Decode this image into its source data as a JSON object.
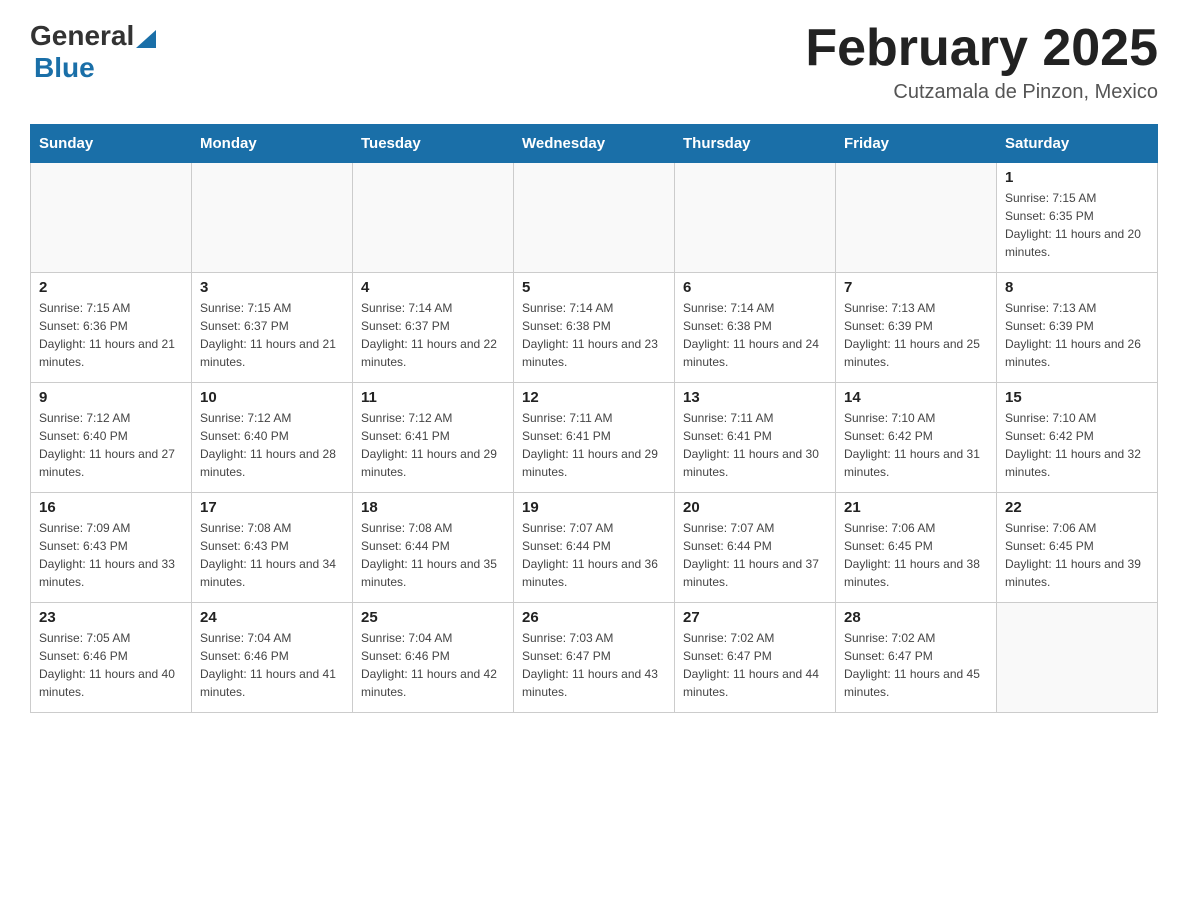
{
  "header": {
    "logo": {
      "general": "General",
      "blue": "Blue"
    },
    "title": "February 2025",
    "location": "Cutzamala de Pinzon, Mexico"
  },
  "days_of_week": [
    "Sunday",
    "Monday",
    "Tuesday",
    "Wednesday",
    "Thursday",
    "Friday",
    "Saturday"
  ],
  "weeks": [
    [
      {
        "day": "",
        "info": ""
      },
      {
        "day": "",
        "info": ""
      },
      {
        "day": "",
        "info": ""
      },
      {
        "day": "",
        "info": ""
      },
      {
        "day": "",
        "info": ""
      },
      {
        "day": "",
        "info": ""
      },
      {
        "day": "1",
        "info": "Sunrise: 7:15 AM\nSunset: 6:35 PM\nDaylight: 11 hours and 20 minutes."
      }
    ],
    [
      {
        "day": "2",
        "info": "Sunrise: 7:15 AM\nSunset: 6:36 PM\nDaylight: 11 hours and 21 minutes."
      },
      {
        "day": "3",
        "info": "Sunrise: 7:15 AM\nSunset: 6:37 PM\nDaylight: 11 hours and 21 minutes."
      },
      {
        "day": "4",
        "info": "Sunrise: 7:14 AM\nSunset: 6:37 PM\nDaylight: 11 hours and 22 minutes."
      },
      {
        "day": "5",
        "info": "Sunrise: 7:14 AM\nSunset: 6:38 PM\nDaylight: 11 hours and 23 minutes."
      },
      {
        "day": "6",
        "info": "Sunrise: 7:14 AM\nSunset: 6:38 PM\nDaylight: 11 hours and 24 minutes."
      },
      {
        "day": "7",
        "info": "Sunrise: 7:13 AM\nSunset: 6:39 PM\nDaylight: 11 hours and 25 minutes."
      },
      {
        "day": "8",
        "info": "Sunrise: 7:13 AM\nSunset: 6:39 PM\nDaylight: 11 hours and 26 minutes."
      }
    ],
    [
      {
        "day": "9",
        "info": "Sunrise: 7:12 AM\nSunset: 6:40 PM\nDaylight: 11 hours and 27 minutes."
      },
      {
        "day": "10",
        "info": "Sunrise: 7:12 AM\nSunset: 6:40 PM\nDaylight: 11 hours and 28 minutes."
      },
      {
        "day": "11",
        "info": "Sunrise: 7:12 AM\nSunset: 6:41 PM\nDaylight: 11 hours and 29 minutes."
      },
      {
        "day": "12",
        "info": "Sunrise: 7:11 AM\nSunset: 6:41 PM\nDaylight: 11 hours and 29 minutes."
      },
      {
        "day": "13",
        "info": "Sunrise: 7:11 AM\nSunset: 6:41 PM\nDaylight: 11 hours and 30 minutes."
      },
      {
        "day": "14",
        "info": "Sunrise: 7:10 AM\nSunset: 6:42 PM\nDaylight: 11 hours and 31 minutes."
      },
      {
        "day": "15",
        "info": "Sunrise: 7:10 AM\nSunset: 6:42 PM\nDaylight: 11 hours and 32 minutes."
      }
    ],
    [
      {
        "day": "16",
        "info": "Sunrise: 7:09 AM\nSunset: 6:43 PM\nDaylight: 11 hours and 33 minutes."
      },
      {
        "day": "17",
        "info": "Sunrise: 7:08 AM\nSunset: 6:43 PM\nDaylight: 11 hours and 34 minutes."
      },
      {
        "day": "18",
        "info": "Sunrise: 7:08 AM\nSunset: 6:44 PM\nDaylight: 11 hours and 35 minutes."
      },
      {
        "day": "19",
        "info": "Sunrise: 7:07 AM\nSunset: 6:44 PM\nDaylight: 11 hours and 36 minutes."
      },
      {
        "day": "20",
        "info": "Sunrise: 7:07 AM\nSunset: 6:44 PM\nDaylight: 11 hours and 37 minutes."
      },
      {
        "day": "21",
        "info": "Sunrise: 7:06 AM\nSunset: 6:45 PM\nDaylight: 11 hours and 38 minutes."
      },
      {
        "day": "22",
        "info": "Sunrise: 7:06 AM\nSunset: 6:45 PM\nDaylight: 11 hours and 39 minutes."
      }
    ],
    [
      {
        "day": "23",
        "info": "Sunrise: 7:05 AM\nSunset: 6:46 PM\nDaylight: 11 hours and 40 minutes."
      },
      {
        "day": "24",
        "info": "Sunrise: 7:04 AM\nSunset: 6:46 PM\nDaylight: 11 hours and 41 minutes."
      },
      {
        "day": "25",
        "info": "Sunrise: 7:04 AM\nSunset: 6:46 PM\nDaylight: 11 hours and 42 minutes."
      },
      {
        "day": "26",
        "info": "Sunrise: 7:03 AM\nSunset: 6:47 PM\nDaylight: 11 hours and 43 minutes."
      },
      {
        "day": "27",
        "info": "Sunrise: 7:02 AM\nSunset: 6:47 PM\nDaylight: 11 hours and 44 minutes."
      },
      {
        "day": "28",
        "info": "Sunrise: 7:02 AM\nSunset: 6:47 PM\nDaylight: 11 hours and 45 minutes."
      },
      {
        "day": "",
        "info": ""
      }
    ]
  ]
}
